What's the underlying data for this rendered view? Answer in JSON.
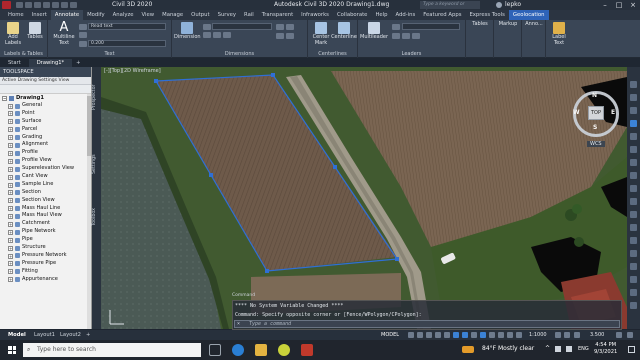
{
  "window": {
    "app_name": "Civil 3D 2020",
    "title": "Autodesk Civil 3D 2020    Drawing1.dwg",
    "search_placeholder": "Type a keyword or phrase",
    "user": "lepko"
  },
  "ribbon_tabs": [
    "Home",
    "Insert",
    "Annotate",
    "Modify",
    "Analyze",
    "View",
    "Manage",
    "Output",
    "Survey",
    "Rail",
    "Transparent",
    "Infraworks",
    "Collaborate",
    "Help",
    "Add-ins",
    "Featured Apps",
    "Express Tools",
    "Geolocation"
  ],
  "ribbon_active_tab": "Annotate",
  "ribbon": {
    "labels_panel": {
      "add_labels": "Add\nLabels",
      "tables": "Tables",
      "title": "Labels & Tables"
    },
    "text_panel": {
      "multiline_text": "Multiline\nText",
      "style_value": "Read text",
      "height_value": "0.200",
      "title": "Text"
    },
    "dimensions_panel": {
      "dimension": "Dimension",
      "title": "Dimensions"
    },
    "centerlines_panel": {
      "center_mark": "Center\nMark",
      "centerline": "Centerline",
      "title": "Centerlines"
    },
    "leaders_panel": {
      "multileader": "Multileader",
      "title": "Leaders"
    },
    "tables_btn": "Tables",
    "markup_btn": "Markup",
    "anno_btn": "Anno...",
    "label_text_btn": "Label Text"
  },
  "file_tabs": [
    "Start",
    "Drawing1*"
  ],
  "toolspace": {
    "title": "TOOLSPACE",
    "view_label": "Active Drawing Settings View",
    "root": "Drawing1",
    "items": [
      "General",
      "Point",
      "Surface",
      "Parcel",
      "Grading",
      "Alignment",
      "Profile",
      "Profile View",
      "Superelevation View",
      "Cant View",
      "Sample Line",
      "Section",
      "Section View",
      "Mass Haul Line",
      "Mass Haul View",
      "Catchment",
      "Pipe Network",
      "Pipe",
      "Structure",
      "Pressure Network",
      "Pressure Pipe",
      "Fitting",
      "Appurtenance"
    ]
  },
  "side_tabs": [
    "Prospector",
    "Settings",
    "Toolbox"
  ],
  "viewport": {
    "label": "[-][Top][2D Wireframe]",
    "viewcube_top": "TOP",
    "compass": {
      "n": "N",
      "s": "S",
      "e": "E",
      "w": "W"
    },
    "wcs": "WCS",
    "parcel_color": "#2f6fd6"
  },
  "command": {
    "line1": "**** No System Variable Changed ****",
    "line2": "Command: Specify opposite corner or [Fence/WPolygon/CPolygon]:",
    "input_placeholder": "Type a command",
    "window_label": "Command"
  },
  "layout_tabs": [
    "Model",
    "Layout1",
    "Layout2"
  ],
  "status": {
    "model": "MODEL",
    "scale": "1:1000",
    "zoom": "3.500"
  },
  "taskbar": {
    "search_placeholder": "Type here to search",
    "weather": "84°F  Mostly clear",
    "lang": "ENG",
    "time": "4:54 PM",
    "date": "9/3/2021"
  }
}
